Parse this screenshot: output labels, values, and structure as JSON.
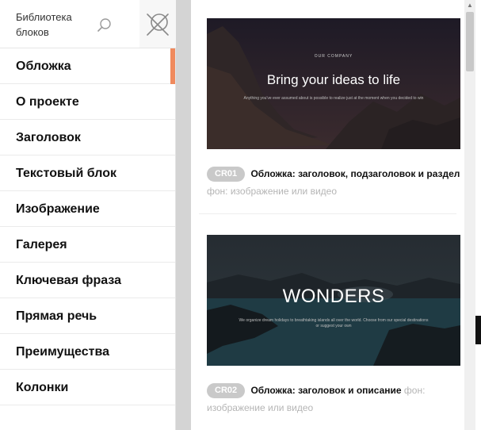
{
  "sidebar": {
    "title": "Библиотека блоков",
    "search_icon": "search-icon",
    "close_icon": "close-icon",
    "accent_color": "#f08a5d",
    "active_index": 0,
    "items": [
      {
        "label": "Обложка"
      },
      {
        "label": "О проекте"
      },
      {
        "label": "Заголовок"
      },
      {
        "label": "Текстовый блок"
      },
      {
        "label": "Изображение"
      },
      {
        "label": "Галерея"
      },
      {
        "label": "Ключевая фраза"
      },
      {
        "label": "Прямая речь"
      },
      {
        "label": "Преимущества"
      },
      {
        "label": "Колонки"
      }
    ]
  },
  "cards": [
    {
      "preview": {
        "overline": "OUR COMPANY",
        "title": "Bring your ideas to life",
        "subtitle": "Anything you've ever assumed about is possible to realize just at the moment when you decided to win"
      },
      "code": "CR01",
      "name": "Обложка: заголовок, подзаголовок и раздел",
      "meta": "фон: изображение или видео"
    },
    {
      "preview": {
        "title": "WONDERS",
        "subtitle": "We organize dream holidays to breathtaking islands all over the world. Choose from our special destinations or suggest your own"
      },
      "code": "CR02",
      "name": "Обложка: заголовок и описание",
      "meta": "фон: изображение или видео"
    }
  ]
}
